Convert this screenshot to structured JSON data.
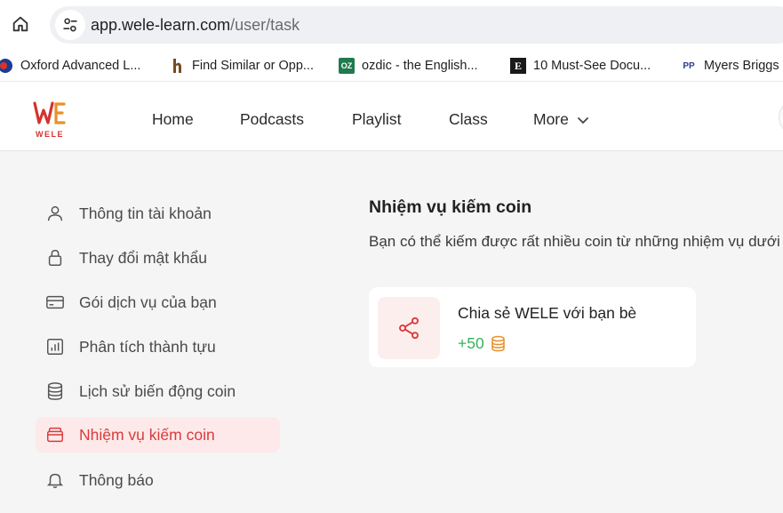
{
  "browser": {
    "url_domain": "app.wele-learn.com",
    "url_path": "/user/task"
  },
  "bookmarks": [
    {
      "label": "Oxford Advanced L...",
      "icon": "oxford-favicon"
    },
    {
      "label": "Find Similar or Opp...",
      "icon": "h-favicon"
    },
    {
      "label": "ozdic - the English...",
      "icon": "ozdic-favicon",
      "icon_text": "OZ"
    },
    {
      "label": "10 Must-See Docu...",
      "icon": "e-favicon",
      "icon_text": "E"
    },
    {
      "label": "Myers Briggs",
      "icon": "pp-favicon",
      "icon_text": "PP"
    }
  ],
  "header": {
    "logo_text": "WELE",
    "nav": [
      "Home",
      "Podcasts",
      "Playlist",
      "Class",
      "More"
    ]
  },
  "sidebar": {
    "items": [
      {
        "label": "Thông tin tài khoản",
        "icon": "user-icon"
      },
      {
        "label": "Thay đổi mật khẩu",
        "icon": "lock-icon"
      },
      {
        "label": "Gói dịch vụ của bạn",
        "icon": "card-icon"
      },
      {
        "label": "Phân tích thành tựu",
        "icon": "chart-icon"
      },
      {
        "label": "Lịch sử biến động coin",
        "icon": "coins-icon"
      },
      {
        "label": "Nhiệm vụ kiếm coin",
        "icon": "wallet-icon",
        "active": true
      },
      {
        "label": "Thông báo",
        "icon": "bell-icon"
      }
    ]
  },
  "main": {
    "title": "Nhiệm vụ kiếm coin",
    "description": "Bạn có thể kiếm được rất nhiều coin từ những nhiệm vụ dưới đây",
    "tasks": [
      {
        "title": "Chia sẻ WELE với bạn bè",
        "reward": "+50",
        "icon": "share-icon"
      }
    ]
  },
  "colors": {
    "accent": "#d93b3b",
    "active_bg": "#fde9e9",
    "reward_green": "#35b35a",
    "coin_orange": "#e8902b"
  }
}
